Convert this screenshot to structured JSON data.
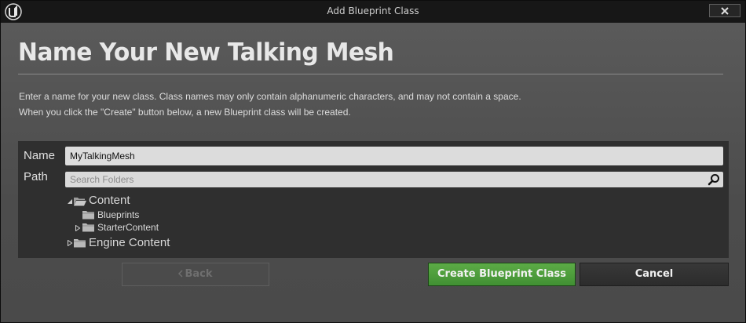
{
  "window": {
    "title": "Add Blueprint Class",
    "logo_icon": "unreal-engine-logo-icon",
    "close_icon": "close-icon"
  },
  "header": {
    "title": "Name Your New Talking Mesh",
    "description_line1": "Enter a name for your new class. Class names may only contain alphanumeric characters, and may not contain a space.",
    "description_line2": "When you click the \"Create\" button below, a new Blueprint class will be created."
  },
  "form": {
    "name_label": "Name",
    "name_value": "MyTalkingMesh",
    "path_label": "Path",
    "search_placeholder": "Search Folders",
    "search_icon": "search-icon"
  },
  "folder_tree": [
    {
      "label": "Content",
      "expanded": true,
      "icon": "folder-open-icon"
    },
    {
      "label": "Blueprints",
      "expanded": null,
      "icon": "folder-icon"
    },
    {
      "label": "StarterContent",
      "expanded": false,
      "icon": "folder-icon"
    },
    {
      "label": "Engine Content",
      "expanded": false,
      "icon": "folder-icon"
    }
  ],
  "buttons": {
    "back": "Back",
    "back_icon": "chevron-left-icon",
    "create": "Create Blueprint Class",
    "cancel": "Cancel"
  },
  "colors": {
    "accent_green": "#4f9f3e",
    "panel_dark": "#2f2f2f",
    "window_bg": "#505050"
  }
}
